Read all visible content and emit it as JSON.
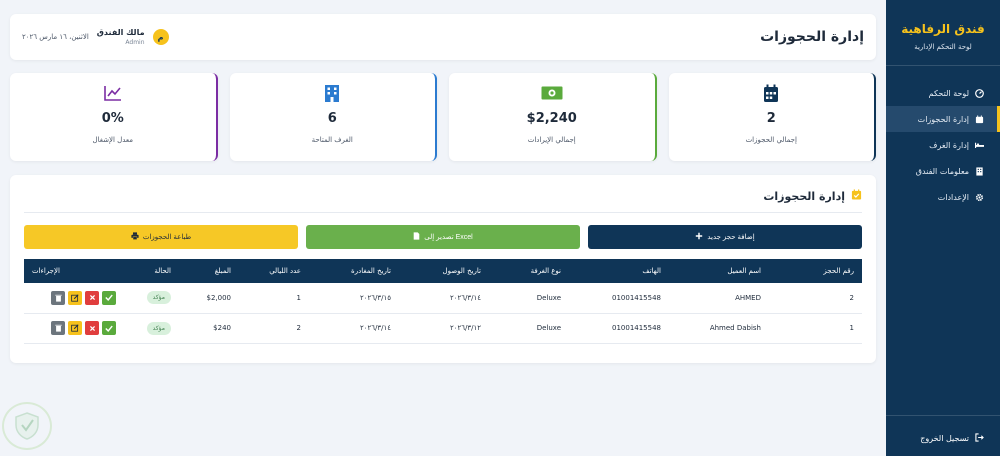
{
  "sidebar": {
    "brand_title": "فندق الرفاهية",
    "brand_subtitle": "لوحة التحكم الإدارية",
    "items": [
      {
        "label": "لوحة التحكم",
        "icon": "dashboard-icon",
        "active": false
      },
      {
        "label": "إدارة الحجوزات",
        "icon": "calendar-icon",
        "active": true
      },
      {
        "label": "إدارة الغرف",
        "icon": "bed-icon",
        "active": false
      },
      {
        "label": "معلومات الفندق",
        "icon": "building-icon",
        "active": false
      },
      {
        "label": "الإعدادات",
        "icon": "gear-icon",
        "active": false
      }
    ],
    "logout": "تسجيل الخروج"
  },
  "header": {
    "title": "إدارة الحجوزات",
    "user_name": "مالك الفندق",
    "user_role": "Admin",
    "avatar_letter": "م",
    "date": "الاثنين، ١٦ مارس ٢٠٢٦"
  },
  "stats": [
    {
      "value": "2",
      "label": "إجمالي الحجوزات",
      "icon": "calendar-icon",
      "color": "#0f3557"
    },
    {
      "value": "$2,240",
      "label": "إجمالي الإيرادات",
      "icon": "money-icon",
      "color": "#5aaa3c"
    },
    {
      "value": "6",
      "label": "الغرف المتاحة",
      "icon": "building-icon",
      "color": "#2b7bd0"
    },
    {
      "value": "0%",
      "label": "معدل الإشغال",
      "icon": "chart-line-icon",
      "color": "#7b2da3"
    }
  ],
  "panel": {
    "title": "إدارة الحجوزات",
    "buttons": {
      "add": "إضافة حجز جديد",
      "excel": "تصدير إلى Excel",
      "print": "طباعة الحجوزات"
    },
    "columns": [
      "رقم الحجز",
      "اسم العميل",
      "الهاتف",
      "نوع الغرفة",
      "تاريخ الوصول",
      "تاريخ المغادرة",
      "عدد الليالي",
      "المبلغ",
      "الحالة",
      "الإجراءات"
    ],
    "rows": [
      {
        "id": "2",
        "name": "AHMED",
        "phone": "01001415548",
        "room": "Deluxe",
        "checkin": "٢٠٢٦/٣/١٤",
        "checkout": "٢٠٢٦/٣/١٥",
        "nights": "1",
        "amount": "$2,000",
        "status": "مؤكد"
      },
      {
        "id": "1",
        "name": "Ahmed Dabish",
        "phone": "01001415548",
        "room": "Deluxe",
        "checkin": "٢٠٢٦/٣/١٢",
        "checkout": "٢٠٢٦/٣/١٤",
        "nights": "2",
        "amount": "$240",
        "status": "مؤكد"
      }
    ]
  }
}
